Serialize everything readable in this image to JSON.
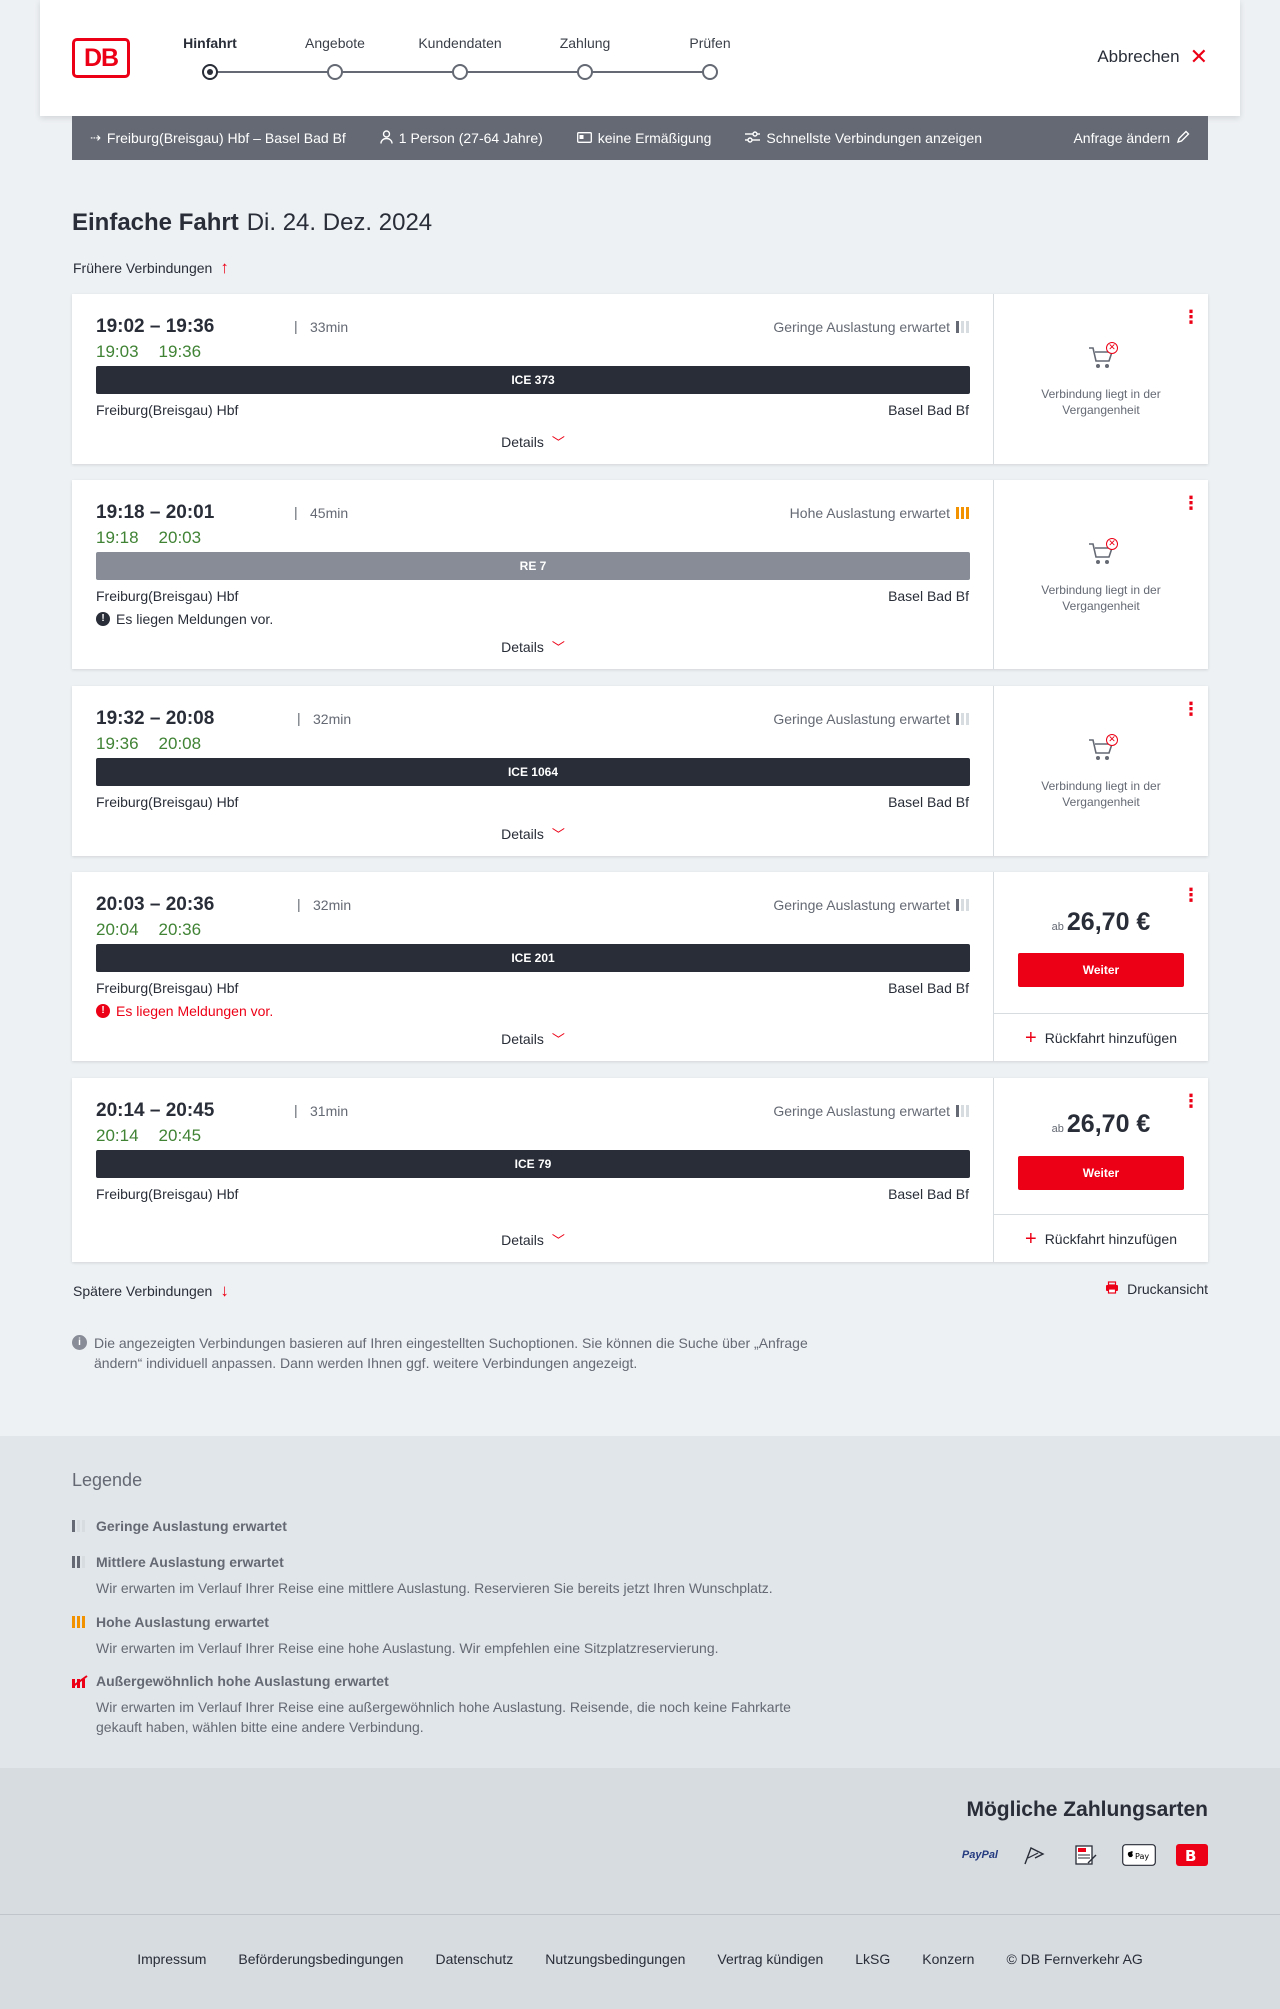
{
  "header": {
    "logo": "DB",
    "steps": [
      {
        "label": "Hinfahrt",
        "active": true
      },
      {
        "label": "Angebote",
        "active": false
      },
      {
        "label": "Kundendaten",
        "active": false
      },
      {
        "label": "Zahlung",
        "active": false
      },
      {
        "label": "Prüfen",
        "active": false
      }
    ],
    "cancel_label": "Abbrechen"
  },
  "search": {
    "route": "Freiburg(Breisgau) Hbf – Basel Bad Bf",
    "travellers": "1 Person (27-64 Jahre)",
    "discount": "keine Ermäßigung",
    "fastest": "Schnellste Verbindungen anzeigen",
    "change": "Anfrage ändern"
  },
  "page": {
    "title": "Einfache Fahrt",
    "date": "Di. 24. Dez. 2024",
    "earlier": "Frühere Verbindungen",
    "later": "Spätere Verbindungen",
    "print": "Druckansicht",
    "details_label": "Details",
    "info": "Die angezeigten Verbindungen basieren auf Ihren eingestellten Suchoptionen. Sie können die Suche über „Anfrage ändern“ individuell anpassen. Dann werden Ihnen ggf. weitere Verbindungen angezeigt."
  },
  "connections": [
    {
      "times": "19:02 – 19:36",
      "duration": "33min",
      "rt_dep": "19:03",
      "rt_arr": "19:36",
      "load": "Geringe Auslastung erwartet",
      "load_level": "low",
      "train": "ICE 373",
      "train_type": "ice",
      "from": "Freiburg(Breisgau) Hbf",
      "to": "Basel Bad Bf",
      "message": "",
      "past_text": "Verbindung liegt in der Vergangenheit"
    },
    {
      "times": "19:18 – 20:01",
      "duration": "45min",
      "rt_dep": "19:18",
      "rt_arr": "20:03",
      "load": "Hohe Auslastung erwartet",
      "load_level": "high",
      "train": "RE 7",
      "train_type": "regional",
      "from": "Freiburg(Breisgau) Hbf",
      "to": "Basel Bad Bf",
      "message": "Es liegen Meldungen vor.",
      "past_text": "Verbindung liegt in der Vergangenheit"
    },
    {
      "times": "19:32 – 20:08",
      "duration": "32min",
      "rt_dep": "19:36",
      "rt_arr": "20:08",
      "load": "Geringe Auslastung erwartet",
      "load_level": "low",
      "train": "ICE 1064",
      "train_type": "ice",
      "from": "Freiburg(Breisgau) Hbf",
      "to": "Basel Bad Bf",
      "message": "",
      "past_text": "Verbindung liegt in der Vergangenheit"
    },
    {
      "times": "20:03 – 20:36",
      "duration": "32min",
      "rt_dep": "20:04",
      "rt_arr": "20:36",
      "load": "Geringe Auslastung erwartet",
      "load_level": "low",
      "train": "ICE 201",
      "train_type": "ice",
      "from": "Freiburg(Breisgau) Hbf",
      "to": "Basel Bad Bf",
      "message": "Es liegen Meldungen vor.",
      "price_prefix": "ab",
      "price": "26,70 €",
      "book_label": "Weiter",
      "return_label": "Rückfahrt hinzufügen"
    },
    {
      "times": "20:14 – 20:45",
      "duration": "31min",
      "rt_dep": "20:14",
      "rt_arr": "20:45",
      "load": "Geringe Auslastung erwartet",
      "load_level": "low",
      "train": "ICE 79",
      "train_type": "ice",
      "from": "Freiburg(Breisgau) Hbf",
      "to": "Basel Bad Bf",
      "message": "",
      "price_prefix": "ab",
      "price": "26,70 €",
      "book_label": "Weiter",
      "return_label": "Rückfahrt hinzufügen"
    }
  ],
  "legend": {
    "title": "Legende",
    "items": [
      {
        "title": "Geringe Auslastung erwartet",
        "text": ""
      },
      {
        "title": "Mittlere Auslastung erwartet",
        "text": "Wir erwarten im Verlauf Ihrer Reise eine mittlere Auslastung. Reservieren Sie bereits jetzt Ihren Wunschplatz."
      },
      {
        "title": "Hohe Auslastung erwartet",
        "text": "Wir erwarten im Verlauf Ihrer Reise eine hohe Auslastung. Wir empfehlen eine Sitzplatzreservierung."
      },
      {
        "title": "Außergewöhnlich hohe Auslastung erwartet",
        "text": "Wir erwarten im Verlauf Ihrer Reise eine außergewöhnlich hohe Auslastung. Reisende, die noch keine Fahrkarte gekauft haben, wählen bitte eine andere Verbindung."
      }
    ]
  },
  "payment": {
    "title": "Mögliche Zahlungsarten",
    "paypal": "PayPal",
    "icons": [
      "paypal-icon",
      "credit-card-icon",
      "sepa-icon",
      "apple-pay-icon",
      "db-app-icon"
    ]
  },
  "footer": {
    "links": [
      "Impressum",
      "Beförderungsbedingungen",
      "Datenschutz",
      "Nutzungsbedingungen",
      "Vertrag kündigen",
      "LkSG",
      "Konzern",
      "© DB Fernverkehr AG"
    ]
  },
  "colors": {
    "brand": "#ec0016",
    "realtime": "#408335",
    "text": "#282d37",
    "high_load": "#f39200"
  }
}
